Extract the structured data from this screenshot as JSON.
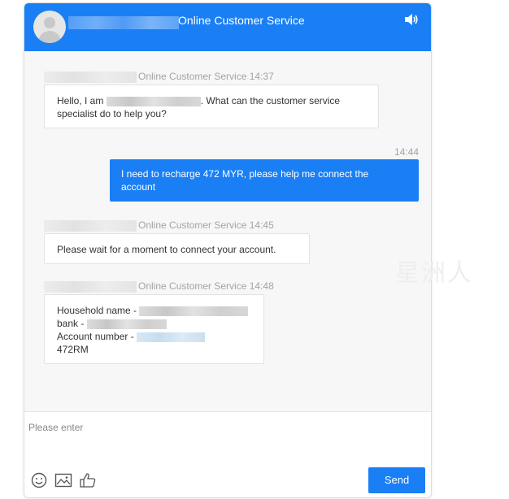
{
  "header": {
    "title": "Online Customer Service"
  },
  "messages": [
    {
      "from": "agent",
      "meta": "Online Customer Service 14:37",
      "text_before": "Hello, I am",
      "text_after": ". What can the customer service",
      "text_line2": "specialist do to help you?"
    },
    {
      "from": "user",
      "time": "14:44",
      "line1": "I need to recharge 472 MYR, please help me connect the",
      "line2": "account"
    },
    {
      "from": "agent",
      "meta": "Online Customer Service 14:45",
      "text": "Please wait for a moment to connect your account."
    },
    {
      "from": "agent",
      "meta": "Online Customer Service 14:48",
      "lines": [
        "Household name -",
        "bank -",
        "Account number -",
        "472RM"
      ]
    }
  ],
  "watermark": "星洲人",
  "input": {
    "placeholder": "Please enter"
  },
  "send_label": "Send",
  "colors": {
    "accent": "#1a7ff5",
    "background": "#f7f7f7"
  }
}
